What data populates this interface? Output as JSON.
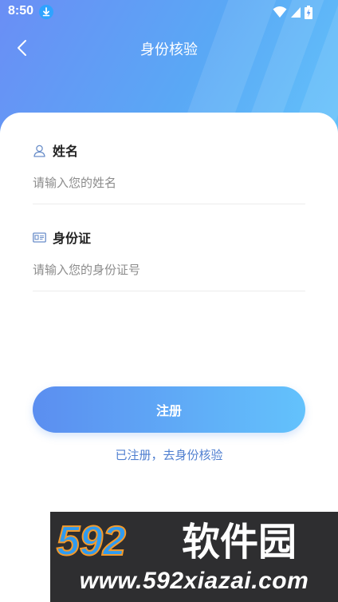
{
  "status_bar": {
    "time": "8:50",
    "download_icon": "download-arrow-icon",
    "wifi_icon": "wifi-icon",
    "signal_icon": "cell-signal-icon",
    "battery_icon": "battery-charging-icon"
  },
  "nav": {
    "back_icon": "chevron-left-icon",
    "title": "身份核验"
  },
  "form": {
    "name_field": {
      "icon": "user-icon",
      "label": "姓名",
      "placeholder": "请输入您的姓名",
      "value": ""
    },
    "id_field": {
      "icon": "id-card-icon",
      "label": "身份证",
      "placeholder": "请输入您的身份证号",
      "value": ""
    },
    "submit_label": "注册",
    "verify_link": "已注册，去身份核验"
  },
  "watermark": {
    "brand_number": "592",
    "brand_name": "软件园",
    "url": "www.592xiazai.com"
  },
  "colors": {
    "header_gradient_start": "#6a8ef5",
    "header_gradient_end": "#63c3fb",
    "button_gradient_start": "#5b8ef0",
    "button_gradient_end": "#63c2fc",
    "link": "#4f7fd0",
    "watermark_orange": "#f39a2b",
    "watermark_blue": "#2f9bf0"
  }
}
